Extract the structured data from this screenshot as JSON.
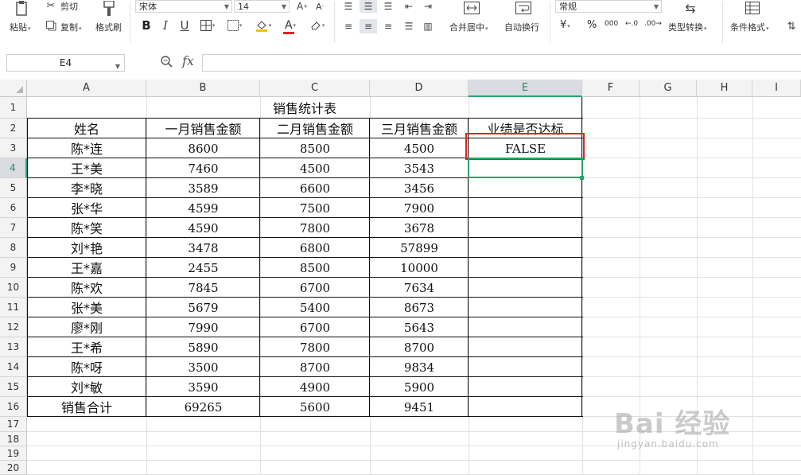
{
  "ribbon": {
    "paste": "粘贴",
    "cut": "剪切",
    "copy": "复制",
    "format_painter": "格式刷",
    "font_name": "宋体",
    "font_size": "14",
    "bold": "B",
    "italic": "I",
    "underline": "U",
    "font_color_glyph": "A",
    "merge_center": "合并居中",
    "wrap_text": "自动换行",
    "number_format": "常规",
    "currency": "¥",
    "percent": "%",
    "thousands": "000",
    "inc_decimal": "←.0",
    "dec_decimal": ".00→",
    "type_convert": "类型转换",
    "conditional_format": "条件格式"
  },
  "formula_bar": {
    "name_box": "E4",
    "fx": "fx",
    "formula": ""
  },
  "sheet": {
    "columns": [
      "A",
      "B",
      "C",
      "D",
      "E",
      "F",
      "G",
      "H",
      "I"
    ],
    "rows": [
      "1",
      "2",
      "3",
      "4",
      "5",
      "6",
      "7",
      "8",
      "9",
      "10",
      "11",
      "12",
      "13",
      "14",
      "15",
      "16",
      "17",
      "18",
      "19",
      "20"
    ],
    "title": "销售统计表",
    "headers": [
      "姓名",
      "一月销售金额",
      "二月销售金额",
      "三月销售金额",
      "业绩是否达标"
    ],
    "data": [
      [
        "陈*连",
        "8600",
        "8500",
        "4500",
        "FALSE"
      ],
      [
        "王*美",
        "7460",
        "4500",
        "3543",
        ""
      ],
      [
        "李*晓",
        "3589",
        "6600",
        "3456",
        ""
      ],
      [
        "张*华",
        "4599",
        "7500",
        "7900",
        ""
      ],
      [
        "陈*笑",
        "4590",
        "7800",
        "3678",
        ""
      ],
      [
        "刘*艳",
        "3478",
        "6800",
        "57899",
        ""
      ],
      [
        "王*嘉",
        "2455",
        "8500",
        "10000",
        ""
      ],
      [
        "陈*欢",
        "7845",
        "6700",
        "7634",
        ""
      ],
      [
        "张*美",
        "5679",
        "5400",
        "8673",
        ""
      ],
      [
        "廖*刚",
        "7990",
        "6700",
        "5643",
        ""
      ],
      [
        "王*希",
        "5890",
        "7800",
        "8700",
        ""
      ],
      [
        "陈*呀",
        "3500",
        "8700",
        "9834",
        ""
      ],
      [
        "刘*敏",
        "3590",
        "4900",
        "5900",
        ""
      ],
      [
        "销售合计",
        "69265",
        "5600",
        "9451",
        ""
      ]
    ],
    "active_cell": "E4",
    "highlighted_cell": "E3"
  },
  "watermark": {
    "brand": "Bai 经验",
    "url": "jingyan.baidu.com"
  },
  "colors": {
    "highlight_red": "#e02424",
    "selection_green": "#24a36b"
  }
}
